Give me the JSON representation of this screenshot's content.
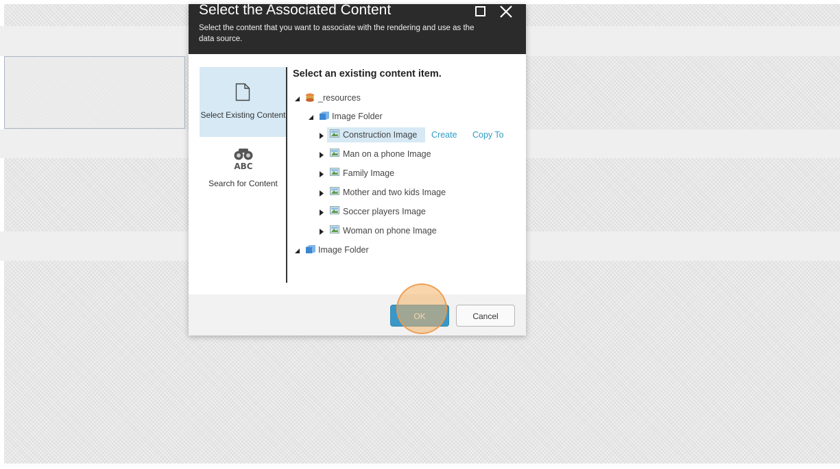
{
  "dialog": {
    "title": "Select the Associated Content",
    "subtitle": "Select the content that you want to associate with the rendering and use as the data source."
  },
  "nav": {
    "items": [
      {
        "label": "Select Existing Content",
        "icon": "document-icon",
        "selected": true
      },
      {
        "label": "Search for Content",
        "icon": "binoculars-abc-icon",
        "selected": false
      }
    ]
  },
  "tree": {
    "heading": "Select an existing content item.",
    "nodes": [
      {
        "label": "_resources",
        "icon": "resources-icon",
        "expanded": true,
        "level": 0
      },
      {
        "label": "Image Folder",
        "icon": "folder-icon",
        "expanded": true,
        "level": 1
      },
      {
        "label": "Construction Image",
        "icon": "image-icon",
        "expanded": false,
        "level": 2,
        "selected": true
      },
      {
        "label": "Man on a phone Image",
        "icon": "image-icon",
        "expanded": false,
        "level": 2
      },
      {
        "label": "Family Image",
        "icon": "image-icon",
        "expanded": false,
        "level": 2
      },
      {
        "label": "Mother and two kids Image",
        "icon": "image-icon",
        "expanded": false,
        "level": 2
      },
      {
        "label": "Soccer players Image",
        "icon": "image-icon",
        "expanded": false,
        "level": 2
      },
      {
        "label": "Woman on phone Image",
        "icon": "image-icon",
        "expanded": false,
        "level": 2
      },
      {
        "label": "Image Folder",
        "icon": "folder-icon",
        "expanded": true,
        "level": 0
      }
    ],
    "actions": {
      "create": "Create",
      "copy_to": "Copy To"
    }
  },
  "footer": {
    "ok_label": "OK",
    "cancel_label": "Cancel"
  },
  "colors": {
    "header_bg": "#2b2b2b",
    "selection_bg": "#d6e9f5",
    "accent": "#3a98c9",
    "link": "#2e9bc4",
    "click_highlight": "#f2b266"
  }
}
